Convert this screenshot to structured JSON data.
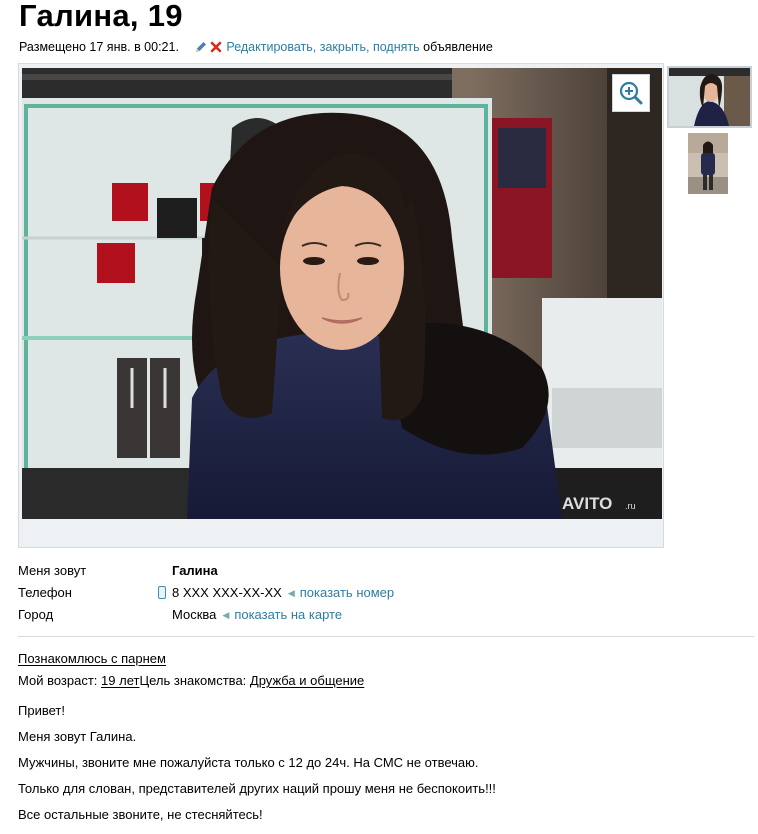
{
  "title": "Галина, 19",
  "meta": {
    "posted": "Размещено 17 янв. в 00:21.",
    "actions_link": "Редактировать, закрыть, поднять",
    "actions_suffix": "объявление"
  },
  "gallery": {
    "watermark": "AVITO",
    "watermark_suffix": ".ru",
    "zoom_icon": "zoom-in-icon",
    "thumbnails": 2
  },
  "details": {
    "name_label": "Меня зовут",
    "name_value": "Галина",
    "phone_label": "Телефон",
    "phone_value": "8 XXX XXX-XX-XX",
    "phone_action": "показать номер",
    "city_label": "Город",
    "city_value": "Москва",
    "city_action": "показать на карте"
  },
  "params": {
    "seeking": "Познакомлюсь с парнем",
    "age_label": "Мой возраст:",
    "age_value": "19 лет",
    "goal_label": "Цель знакомства:",
    "goal_value": "Дружба и общение"
  },
  "description": [
    "Привет!",
    "Меня зовут Галина.",
    "Мужчины, звоните мне пожалуйста только с 12 до 24ч. На СМС не отвечаю.",
    "Только для слован, представителей других наций прошу меня не беспокоить!!!",
    "Все остальные звоните, не стесняйтесь!"
  ],
  "colors": {
    "link": "#2f7d9f",
    "delete": "#d9291c"
  }
}
